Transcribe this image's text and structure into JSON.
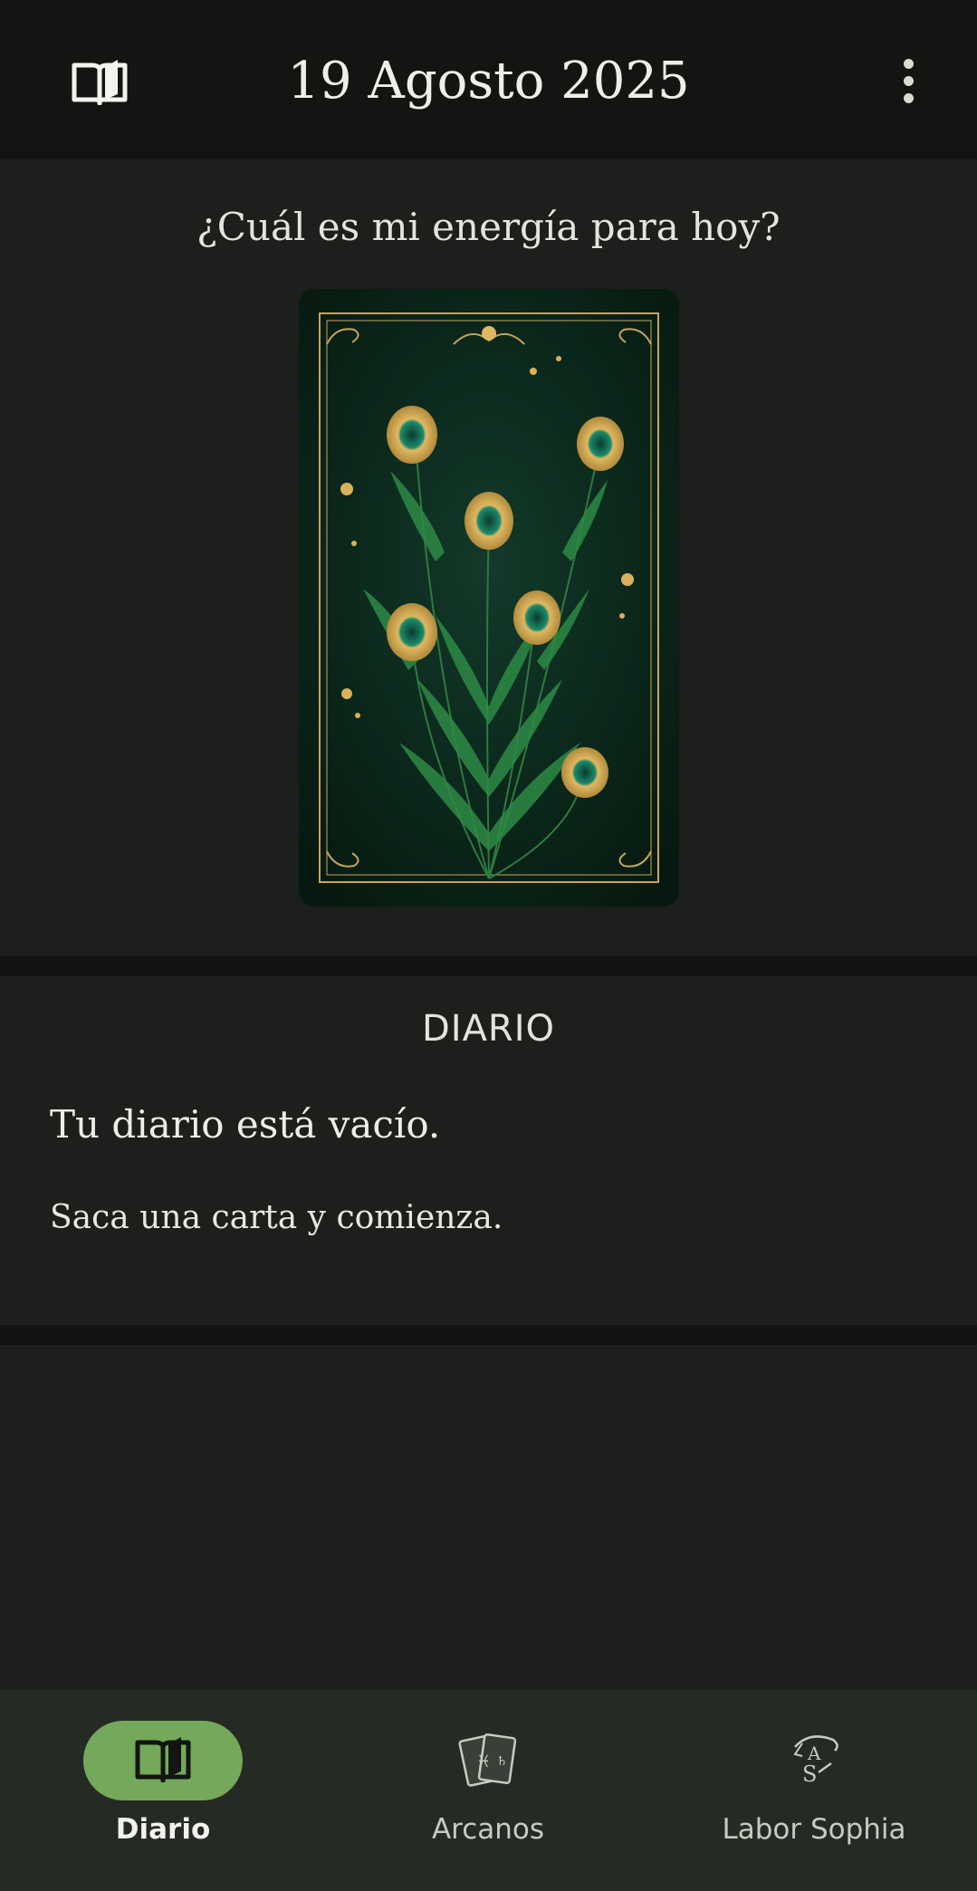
{
  "header": {
    "title": "19 Agosto 2025",
    "left_icon": "open-book-icon",
    "right_icon": "more-vertical-icon"
  },
  "energy": {
    "question": "¿Cuál es mi energía para hoy?",
    "card_image": "peacock-feather-tarot-card"
  },
  "diary": {
    "title": "DIARIO",
    "empty_message": "Tu diario está vacío.",
    "hint": "Saca una carta y comienza."
  },
  "nav": {
    "items": [
      {
        "label": "Diario",
        "icon": "open-book-icon",
        "active": true
      },
      {
        "label": "Arcanos",
        "icon": "tarot-cards-icon",
        "active": false
      },
      {
        "label": "Labor Sophia",
        "icon": "labor-sophia-logo-icon",
        "active": false
      }
    ]
  },
  "colors": {
    "topbar": "#121511",
    "background": "#1c1f1b",
    "accent": "#74a85a",
    "bottom_nav": "#262a24"
  }
}
